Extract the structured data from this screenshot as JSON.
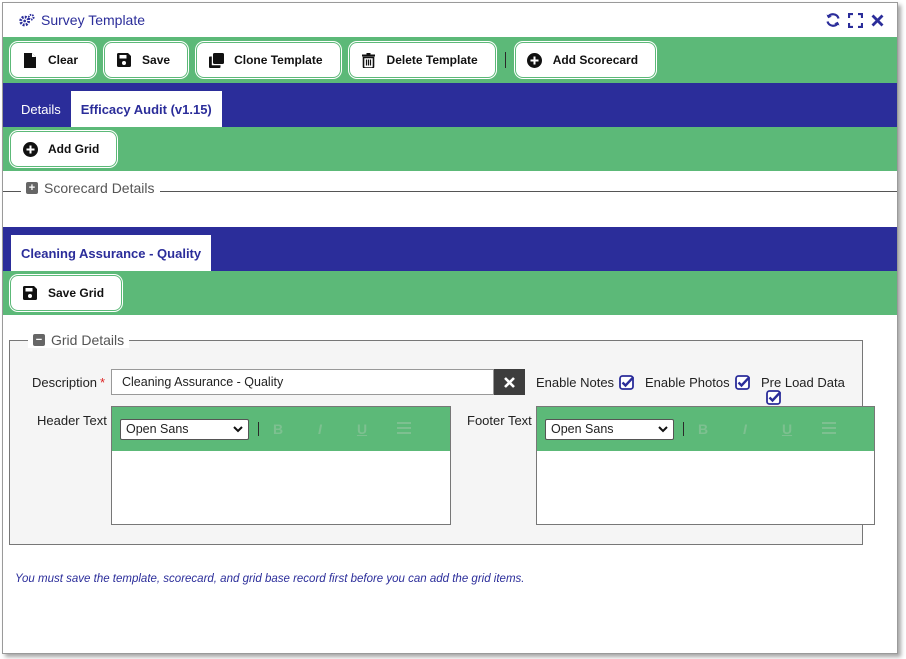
{
  "window": {
    "title": "Survey Template"
  },
  "toolbar": {
    "clear_label": "Clear",
    "save_label": "Save",
    "clone_label": "Clone Template",
    "delete_label": "Delete Template",
    "add_scorecard_label": "Add Scorecard"
  },
  "tabs": [
    {
      "label": "Details"
    },
    {
      "label": "Efficacy Audit (v1.15)"
    }
  ],
  "scorecard_toolbar": {
    "add_grid_label": "Add Grid"
  },
  "scorecard_details": {
    "legend": "Scorecard Details"
  },
  "grid_tabs": [
    {
      "label": "Cleaning Assurance - Quality"
    }
  ],
  "grid_toolbar": {
    "save_grid_label": "Save Grid"
  },
  "grid_details": {
    "legend": "Grid Details",
    "description_label": "Description",
    "required_marker": "*",
    "description_value": "Cleaning Assurance - Quality",
    "enable_notes_label": "Enable Notes",
    "enable_notes_checked": true,
    "enable_photos_label": "Enable Photos",
    "enable_photos_checked": true,
    "preload_label": "Pre Load Data",
    "preload_checked": true,
    "header_text_label": "Header Text",
    "footer_text_label": "Footer Text",
    "header_font": "Open Sans",
    "footer_font": "Open Sans",
    "format_buttons": [
      "B",
      "I",
      "U",
      "list"
    ]
  },
  "note": "You must save the template, scorecard, and grid base record first before you can add the grid items.",
  "colors": {
    "green": "#5cb978",
    "navy": "#2b2d9a",
    "panel": "#f5f5f5"
  }
}
